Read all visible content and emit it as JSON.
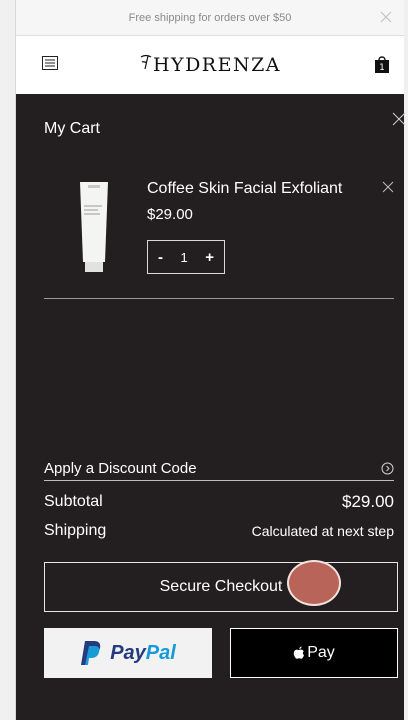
{
  "promo": {
    "text": "Free shipping for orders over $50"
  },
  "header": {
    "brand": "HYDRENZA",
    "bag_count": "1"
  },
  "cart": {
    "title": "My Cart",
    "item": {
      "name": "Coffee Skin Facial Exfoliant",
      "price": "$29.00",
      "quantity": "1",
      "decrement": "-",
      "increment": "+"
    },
    "discount_label": "Apply a Discount Code",
    "subtotal_label": "Subtotal",
    "subtotal_value": "$29.00",
    "shipping_label": "Shipping",
    "shipping_value": "Calculated at next step",
    "checkout_label": "Secure Checkout",
    "paypal_label_a": "Pay",
    "paypal_label_b": "Pal",
    "applepay_label": "Pay"
  },
  "colors": {
    "background": "#231f20",
    "header": "#ffffff",
    "touch": "#b86458"
  }
}
